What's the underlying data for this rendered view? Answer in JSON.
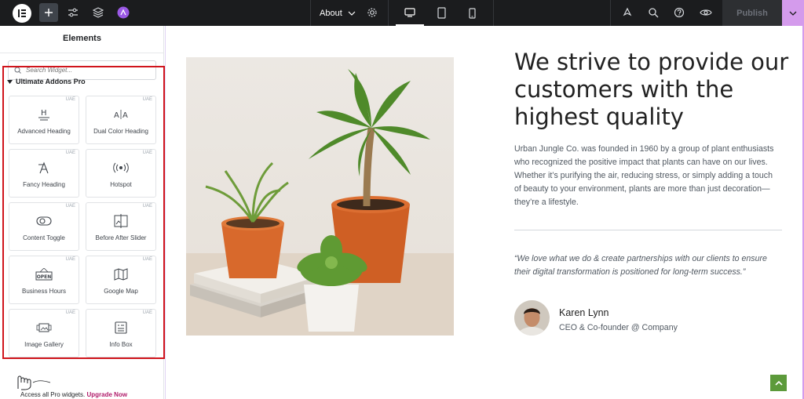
{
  "topbar": {
    "page_name": "About",
    "publish_label": "Publish"
  },
  "sidebar": {
    "title": "Elements",
    "search_placeholder": "Search Widget...",
    "category_title": "Ultimate Addons Pro",
    "widgets": [
      {
        "label": "Advanced Heading",
        "badge": "UAE",
        "icon": "heading-icon"
      },
      {
        "label": "Dual Color Heading",
        "badge": "UAE",
        "icon": "dual-color-heading-icon"
      },
      {
        "label": "Fancy Heading",
        "badge": "UAE",
        "icon": "fancy-heading-icon"
      },
      {
        "label": "Hotspot",
        "badge": "UAE",
        "icon": "hotspot-icon"
      },
      {
        "label": "Content Toggle",
        "badge": "UAE",
        "icon": "toggle-icon"
      },
      {
        "label": "Before After Slider",
        "badge": "UAE",
        "icon": "before-after-icon"
      },
      {
        "label": "Business Hours",
        "badge": "UAE",
        "icon": "open-sign-icon",
        "icon_text": "OPEN"
      },
      {
        "label": "Google Map",
        "badge": "UAE",
        "icon": "map-icon"
      },
      {
        "label": "Image Gallery",
        "badge": "UAE",
        "icon": "gallery-icon"
      },
      {
        "label": "Info Box",
        "badge": "UAE",
        "icon": "info-box-icon"
      }
    ],
    "footer_text": "Access all Pro widgets.",
    "footer_link": "Upgrade Now"
  },
  "content": {
    "headline": "We strive to provide our customers with the highest quality",
    "paragraph": "Urban Jungle Co. was founded in 1960 by a group of plant enthusiasts who recognized the positive impact that plants can have on our lives. Whether it’s purifying the air, reducing stress, or simply adding a touch of beauty to your environment, plants are more than just decoration—they’re a lifestyle.",
    "quote": "“We love what we do & create partnerships with our clients to ensure their digital transformation is positioned for long-term success.”",
    "person_name": "Karen Lynn",
    "person_role": "CEO & Co-founder @ Company"
  },
  "colors": {
    "topbar_bg": "#1b1c1e",
    "highlight_border": "#d0141c",
    "accent_pink": "#d49bec",
    "upgrade_link": "#b01b6a",
    "back_to_top": "#5c9a3b"
  }
}
